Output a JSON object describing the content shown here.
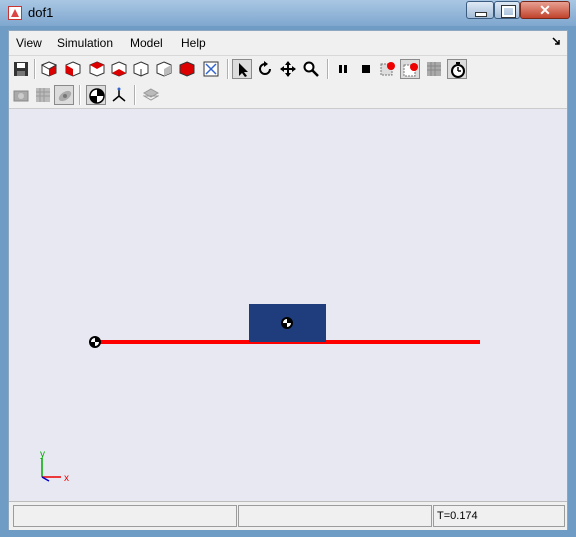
{
  "window": {
    "title": "dof1",
    "close_glyph": "✕"
  },
  "menu": {
    "items": [
      "View",
      "Simulation",
      "Model",
      "Help"
    ],
    "dock_icon": "dock-arrow-icon"
  },
  "toolbar": {
    "row1": [
      "save-icon",
      "view-iso-icon",
      "view-front-icon",
      "view-back-icon",
      "view-left-icon",
      "view-right-icon",
      "view-top-icon",
      "view-bottom-icon",
      "fit-view-icon",
      "select-icon",
      "rotate-icon",
      "pan-icon",
      "zoom-icon",
      "pause-icon",
      "stop-icon",
      "record-icon",
      "record-settings-icon",
      "grid-icon",
      "timer-icon"
    ],
    "row2": [
      "camera-icon",
      "grid-toggle-icon",
      "eye-icon",
      "center-of-mass-icon",
      "frames-icon",
      "layers-icon"
    ]
  },
  "scene": {
    "colors": {
      "ground": "#ff0000",
      "block": "#1f3c7c",
      "canvas": "#e8e8f2"
    },
    "axis_labels": {
      "x": "x",
      "y": "y"
    }
  },
  "status": {
    "time": "T=0.174"
  }
}
